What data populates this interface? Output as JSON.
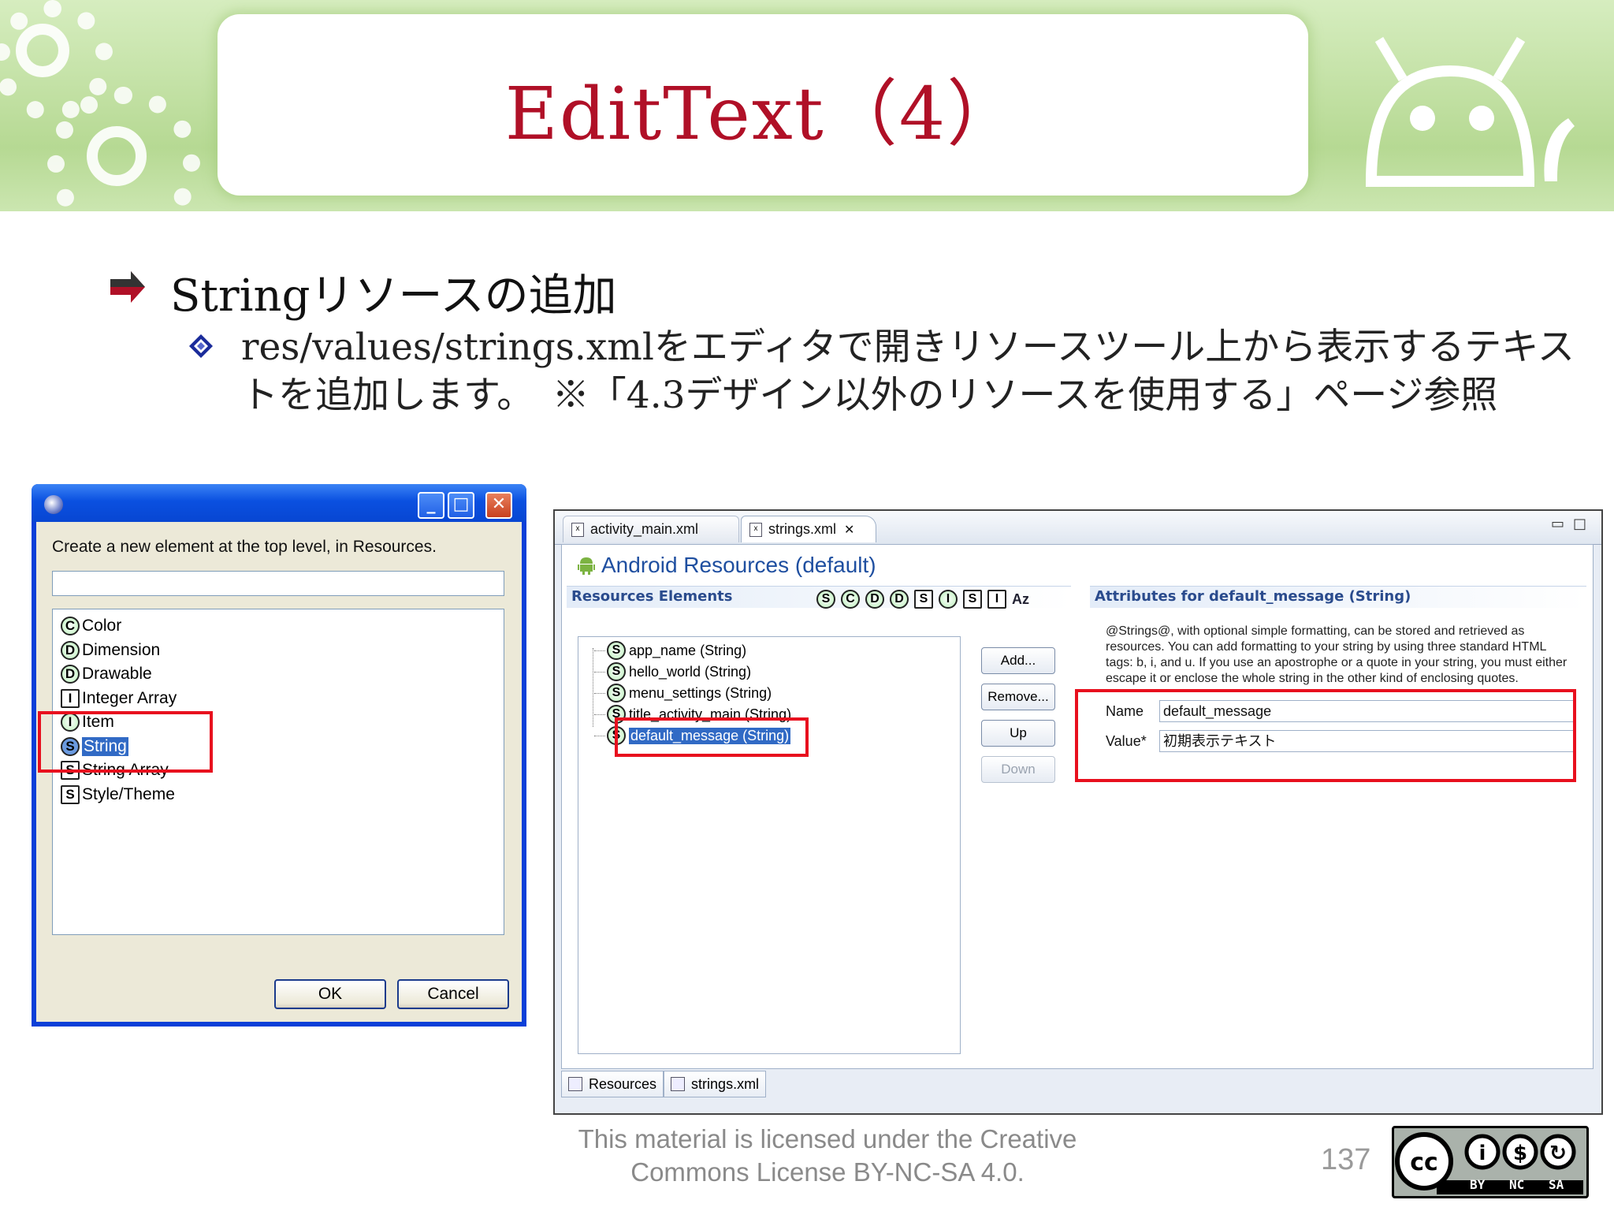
{
  "header": {
    "title": "EditText（4）"
  },
  "bullets": {
    "level1": "Stringリソースの追加",
    "level2": "res/values/strings.xmlをエディタで開きリソースツール上から表示するテキストを追加します。　※「4.3デザイン以外のリソースを使用する」ページ参照"
  },
  "dialog": {
    "prompt": "Create a new element at the top level, in Resources.",
    "filter_value": "",
    "items": [
      {
        "letter": "C",
        "label": "Color",
        "shape": "round"
      },
      {
        "letter": "D",
        "label": "Dimension",
        "shape": "round"
      },
      {
        "letter": "D",
        "label": "Drawable",
        "shape": "round"
      },
      {
        "letter": "I",
        "label": "Integer Array",
        "shape": "square"
      },
      {
        "letter": "I",
        "label": "Item",
        "shape": "round"
      },
      {
        "letter": "S",
        "label": "String",
        "shape": "round",
        "selected": true
      },
      {
        "letter": "S",
        "label": "String Array",
        "shape": "square"
      },
      {
        "letter": "S",
        "label": "Style/Theme",
        "shape": "square"
      }
    ],
    "ok_label": "OK",
    "cancel_label": "Cancel"
  },
  "editor": {
    "tabs": [
      {
        "label": "activity_main.xml"
      },
      {
        "label": "strings.xml"
      }
    ],
    "header_title": "Android Resources (default)",
    "resources_section": "Resources Elements",
    "toolbar_icons": [
      "S",
      "C",
      "D",
      "D",
      "S",
      "I",
      "S",
      "I"
    ],
    "toolbar_az": "Az",
    "tree_items": [
      {
        "letter": "S",
        "label": "app_name (String)"
      },
      {
        "letter": "S",
        "label": "hello_world (String)"
      },
      {
        "letter": "S",
        "label": "menu_settings (String)"
      },
      {
        "letter": "S",
        "label": "title_activity_main (String)"
      },
      {
        "letter": "S",
        "label": "default_message (String)",
        "selected": true
      }
    ],
    "buttons": {
      "add": "Add...",
      "remove": "Remove...",
      "up": "Up",
      "down": "Down"
    },
    "attributes_section": "Attributes for default_message (String)",
    "attributes_description": "@Strings@, with optional simple formatting, can be stored and retrieved as resources. You can add formatting to your string by using three standard HTML tags: b, i, and u. If you use an apostrophe or a quote in your string, you must either escape it or enclose the whole string in the other kind of enclosing quotes.",
    "name_label": "Name",
    "name_value": "default_message",
    "value_label": "Value*",
    "value_value": "初期表示テキスト",
    "bottom_tabs": [
      "Resources",
      "strings.xml"
    ]
  },
  "footer": {
    "license_line1": "This material is licensed under the Creative",
    "license_line2": "Commons License BY-NC-SA 4.0.",
    "page_number": "137",
    "cc_labels": [
      "BY",
      "NC",
      "SA"
    ]
  },
  "colors": {
    "title_red": "#b01027",
    "highlight_red": "#e8101e",
    "selection_blue": "#316ac5",
    "banner_green": "#bfe0a2"
  }
}
